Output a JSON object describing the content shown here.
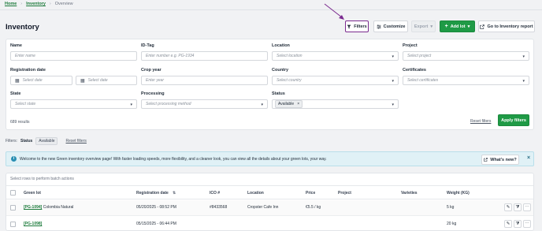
{
  "breadcrumb": {
    "home": "Home",
    "inventory": "Inventory",
    "current": "Overview",
    "sep": "›"
  },
  "page": {
    "title": "Inventory"
  },
  "toolbar": {
    "filters_label": "Filters",
    "customize_label": "Customize",
    "export_label": "Export",
    "add_lot_label": "Add lot",
    "report_label": "Go to Inventory report"
  },
  "filters": {
    "name": {
      "label": "Name",
      "placeholder": "Enter name"
    },
    "id_tag": {
      "label": "ID-Tag",
      "placeholder": "Enter number e.g. PG-1934"
    },
    "location": {
      "label": "Location",
      "placeholder": "Select location"
    },
    "project": {
      "label": "Project",
      "placeholder": "Select project"
    },
    "registration_date": {
      "label": "Registration date",
      "from_placeholder": "Select date",
      "to_placeholder": "Select date"
    },
    "crop_year": {
      "label": "Crop year",
      "placeholder": "Enter year"
    },
    "country": {
      "label": "Country",
      "placeholder": "Select country"
    },
    "certificates": {
      "label": "Certificates",
      "placeholder": "Select certificates"
    },
    "state": {
      "label": "State",
      "placeholder": "Select state"
    },
    "processing": {
      "label": "Processing",
      "placeholder": "Select processing method"
    },
    "status": {
      "label": "Status",
      "selected": "Available",
      "remove": "×"
    },
    "results": "689 results",
    "reset_label": "Reset filters",
    "apply_label": "Apply filters"
  },
  "active_filters": {
    "prefix": "Filters:",
    "status_label": "Status",
    "status_value": "Available",
    "reset_label": "Reset filters"
  },
  "banner": {
    "icon": "i",
    "text": "Welcome to the new Green inventory overview page! With faster loading speeds, more flexibility, and a cleaner look, you can view all the details about your green lots, your way.",
    "whats_new_label": "What's new?",
    "close": "×"
  },
  "table": {
    "batch_hint": "Select rows to perform batch actions",
    "columns": {
      "green_lot": "Green lot",
      "registration_date": "Registration date",
      "ico": "ICO #",
      "location": "Location",
      "price": "Price",
      "project": "Project",
      "varieties": "Varieties",
      "weight": "Weight (KG)"
    },
    "rows": [
      {
        "lot_id": "[PG-1094]",
        "lot_name": "Colombia Natural",
        "registration_date": "05/20/2025 - 08:52 PM",
        "ico": "#8433568",
        "location": "Cropster Cafe Inn",
        "price": "€5.5 / kg",
        "project": "",
        "varieties": "",
        "weight": "5 kg"
      },
      {
        "lot_id": "[PG-1098]",
        "lot_name": "",
        "registration_date": "05/15/2025 - 06:44 PM",
        "ico": "",
        "location": "",
        "price": "",
        "project": "",
        "varieties": "",
        "weight": "20 kg"
      }
    ]
  },
  "colors": {
    "accent_green": "#1f9a46",
    "highlight_purple": "#7b2a8f",
    "banner_bg": "#e0f1f6"
  }
}
